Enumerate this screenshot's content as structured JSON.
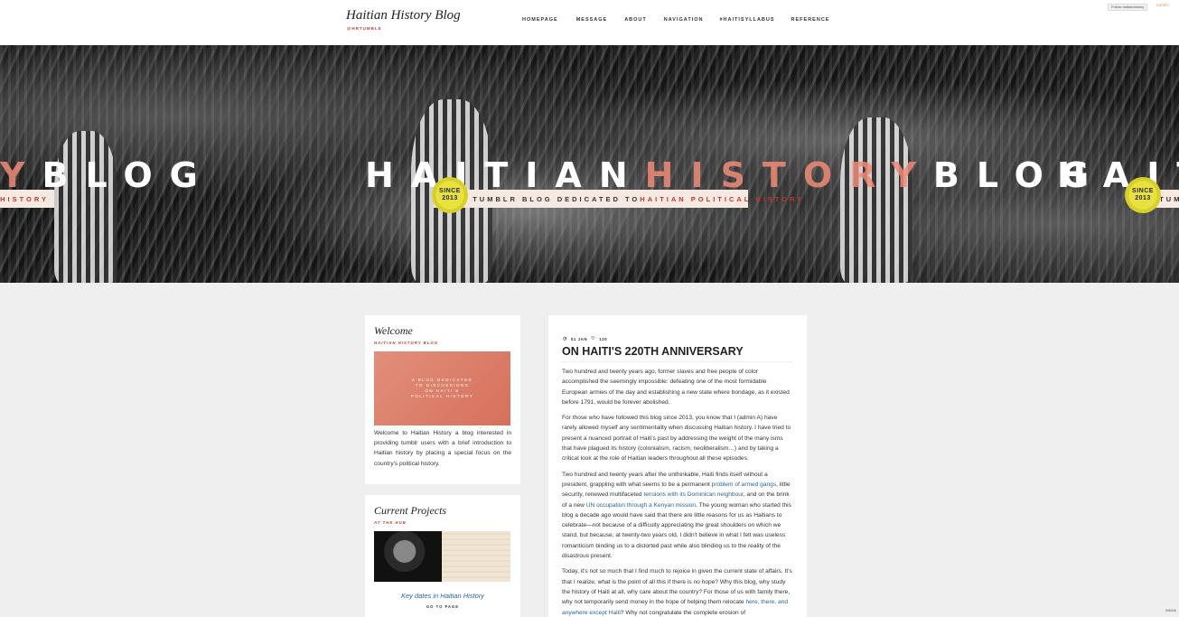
{
  "header": {
    "title": "Haitian History Blog",
    "subtitle": "@HRTUMBLE",
    "nav": [
      "HOMEPAGE",
      "MESSAGE",
      "ABOUT",
      "NAVIGATION",
      "#HAITISYLLABUS",
      "REFERENCE"
    ],
    "follow_label": "Follow haitianhistory",
    "tumblr_label": "tumblr."
  },
  "hero": {
    "left_word_a": "Y",
    "left_word_b": "BLOG",
    "main_a": "HAITIAN",
    "main_b": "HISTORY",
    "main_c": "BLOG",
    "right_word": "HAITI",
    "left_strip": "L HISTORY",
    "strip_a": "A TUMBLR BLOG DEDICATED TO ",
    "strip_b": "HAITIAN POLITICAL HISTORY",
    "right_strip": "A TUMB",
    "since_label": "SINCE",
    "since_year": "2013"
  },
  "welcome": {
    "title": "Welcome",
    "sub": "HAITIAN HISTORY BLOG",
    "image_text": "A BLOG DEDICATED TO DISCUSSIONS ON HAITI'S POLITICAL HISTORY",
    "text": "Welcome to Haitian History a blog interested in providing tumblr users with a brief introduction to Haitian history by placing a special focus on the country's political history."
  },
  "projects": {
    "title": "Current Projects",
    "sub": "AT THE HUB",
    "link": "Key dates in Haitian History",
    "go": "GO TO PAGE"
  },
  "post": {
    "date": "01 JAN",
    "notes": "120",
    "title": "ON HAITI'S 220TH ANNIVERSARY",
    "p1": "Two hundred and twenty years ago, former slaves and free people of color accomplished the seemingly impossible: defeating one of the most formidable European armies of the day and establishing a new state where bondage, as it existed before 1791, would be forever abolished.",
    "p2": "For those who have followed this blog since 2013, you know that I (admin A) have rarely allowed myself any sentimentality when discussing Haitian history. I have tried to present a nuanced portrait of Haiti's past by addressing the weight of the many isms that have plagued its history (colonialism, racism, neoliberalism…) and by taking a critical look at the role of Haitian leaders throughout all these episodes.",
    "p3_a": "Two hundred and twenty years after the unthinkable, Haiti finds itself without a president, grappling with what seems to be a permanent ",
    "p3_link1": "problem of armed gangs",
    "p3_b": ", little security, renewed multifaceted ",
    "p3_link2": "tensions with its Dominican neighbour",
    "p3_c": ", and on the brink of a new ",
    "p3_link3": "UN occupation through a Kenyan mission",
    "p3_d": ". The young woman who started this blog a decade ago would have said that there are little reasons for us as Haitians to celebrate—not because of a difficulty appreciating the great shoulders on which we stand, but because, at twenty-two years old, I didn't believe in what I felt was useless romanticism binding us to a distorted past while also blinding us to the reality of the disastrous present.",
    "p4_a": "Today, it's not so much that I find much to rejoice in given the current state of affairs. It's that I realize, what is the point of all this if there is no hope? Why this blog, why study the history of Haiti at all, why care about the country? For those of us with family there, why not temporarily send money in the hope of helping them relocate ",
    "p4_link": "here, there, and anywhere except Haiti",
    "p4_b": "? Why not congratulate the complete erosion of"
  },
  "corner_label": "598046"
}
